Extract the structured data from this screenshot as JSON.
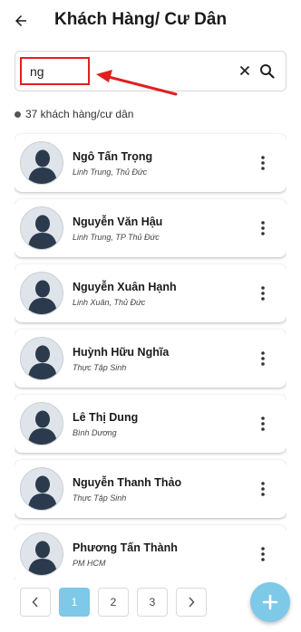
{
  "header": {
    "title": "Khách Hàng/ Cư Dân",
    "back_icon": "arrow-left-icon"
  },
  "search": {
    "value": "ng",
    "placeholder": ""
  },
  "summary": {
    "count_text": "37 khách hàng/cư dân"
  },
  "customers": [
    {
      "name": "Ngô Tấn Trọng",
      "address": "Linh Trung, Thủ Đức"
    },
    {
      "name": "Nguyễn Văn Hậu",
      "address": "Linh Trung, TP Thủ Đức"
    },
    {
      "name": "Nguyễn Xuân Hạnh",
      "address": "Linh Xuân, Thủ Đức"
    },
    {
      "name": "Huỳnh Hữu Nghĩa",
      "address": "Thực Tập Sinh"
    },
    {
      "name": "Lê Thị Dung",
      "address": "Bình Dương"
    },
    {
      "name": "Nguyễn Thanh Thảo",
      "address": "Thực Tập Sinh"
    },
    {
      "name": "Phương Tấn Thành",
      "address": "PM HCM"
    }
  ],
  "pagination": {
    "pages": [
      "1",
      "2",
      "3"
    ],
    "current": "1"
  },
  "colors": {
    "accent": "#7ec8e8",
    "annotation": "#e02020"
  }
}
